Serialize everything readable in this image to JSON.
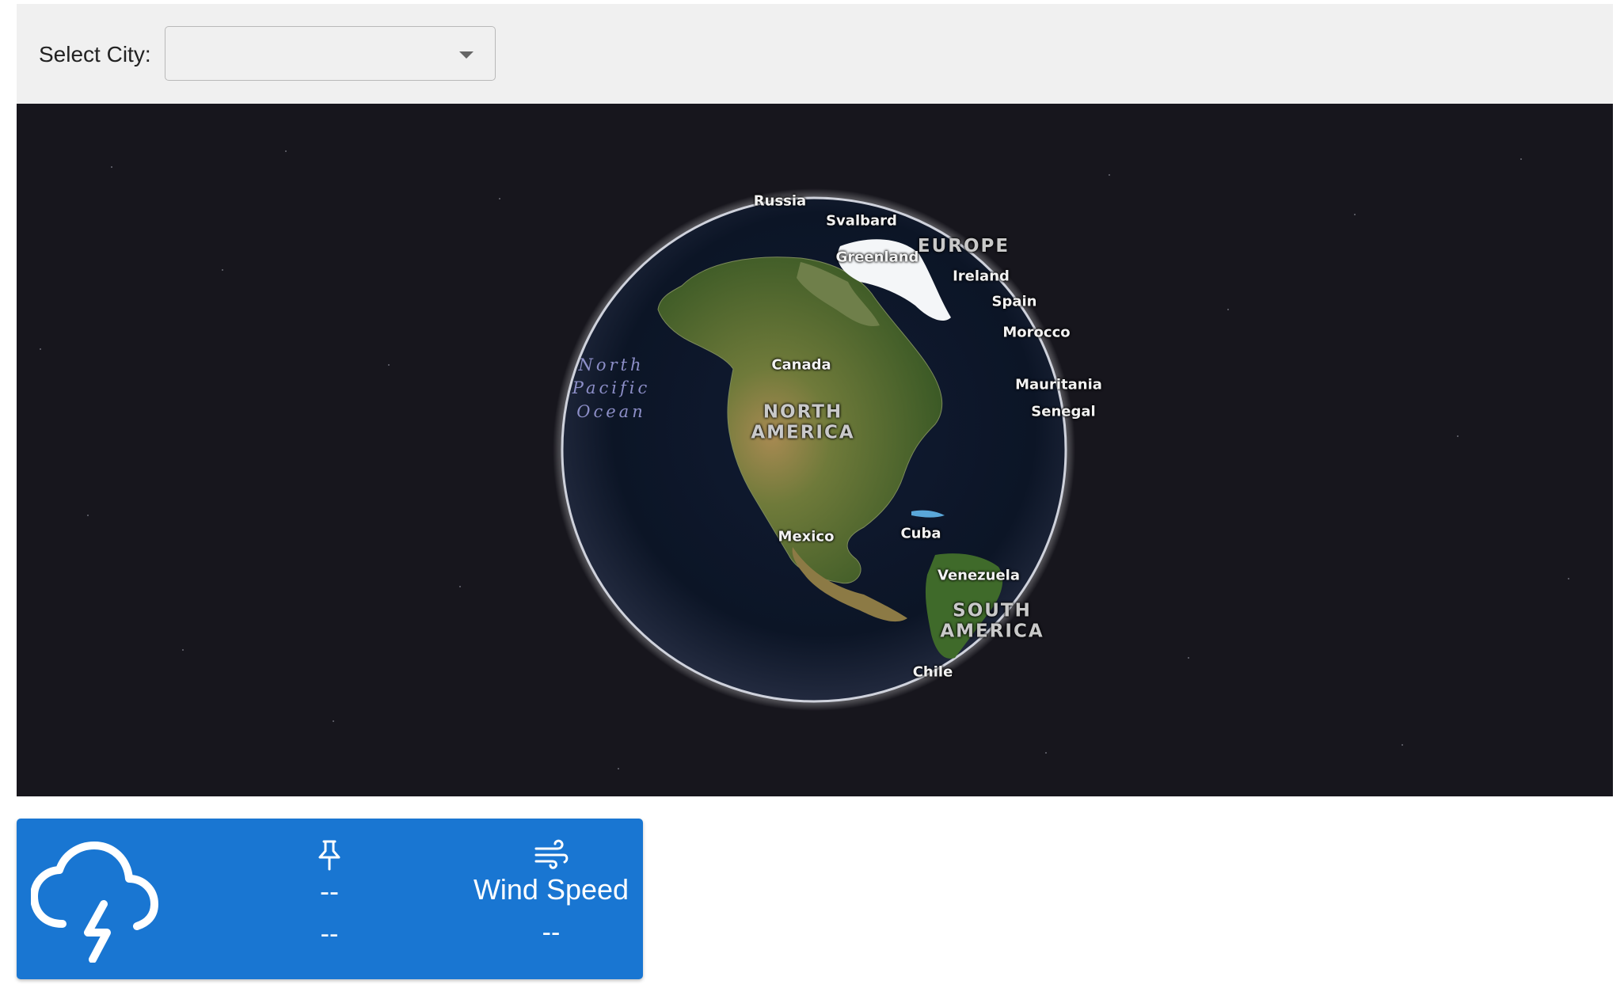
{
  "toolbar": {
    "city_label": "Select City:",
    "city_select": {
      "selected_value": "",
      "icon": "chevron-down-icon"
    }
  },
  "map": {
    "labels": {
      "russia": "Russia",
      "svalbard": "Svalbard",
      "greenland": "Greenland",
      "europe": "EUROPE",
      "ireland": "Ireland",
      "spain": "Spain",
      "morocco": "Morocco",
      "canada": "Canada",
      "north_pacific_ocean": "North\nPacific\nOcean",
      "north_america": "NORTH\nAMERICA",
      "mauritania": "Mauritania",
      "senegal": "Senegal",
      "mexico": "Mexico",
      "cuba": "Cuba",
      "venezuela": "Venezuela",
      "south_america": "SOUTH\nAMERICA",
      "chile": "Chile"
    },
    "colors": {
      "space": "#17161d",
      "ocean": "#0c1526",
      "land": "#4a6a2c",
      "ice": "#f4f6f8"
    }
  },
  "weather": {
    "condition_icon": "cloud-lightning-icon",
    "pressure": {
      "icon": "pushpin-icon",
      "title": "--",
      "value": "--"
    },
    "wind": {
      "icon": "wind-icon",
      "title": "Wind Speed",
      "value": "--"
    },
    "color": "#1976d2"
  }
}
